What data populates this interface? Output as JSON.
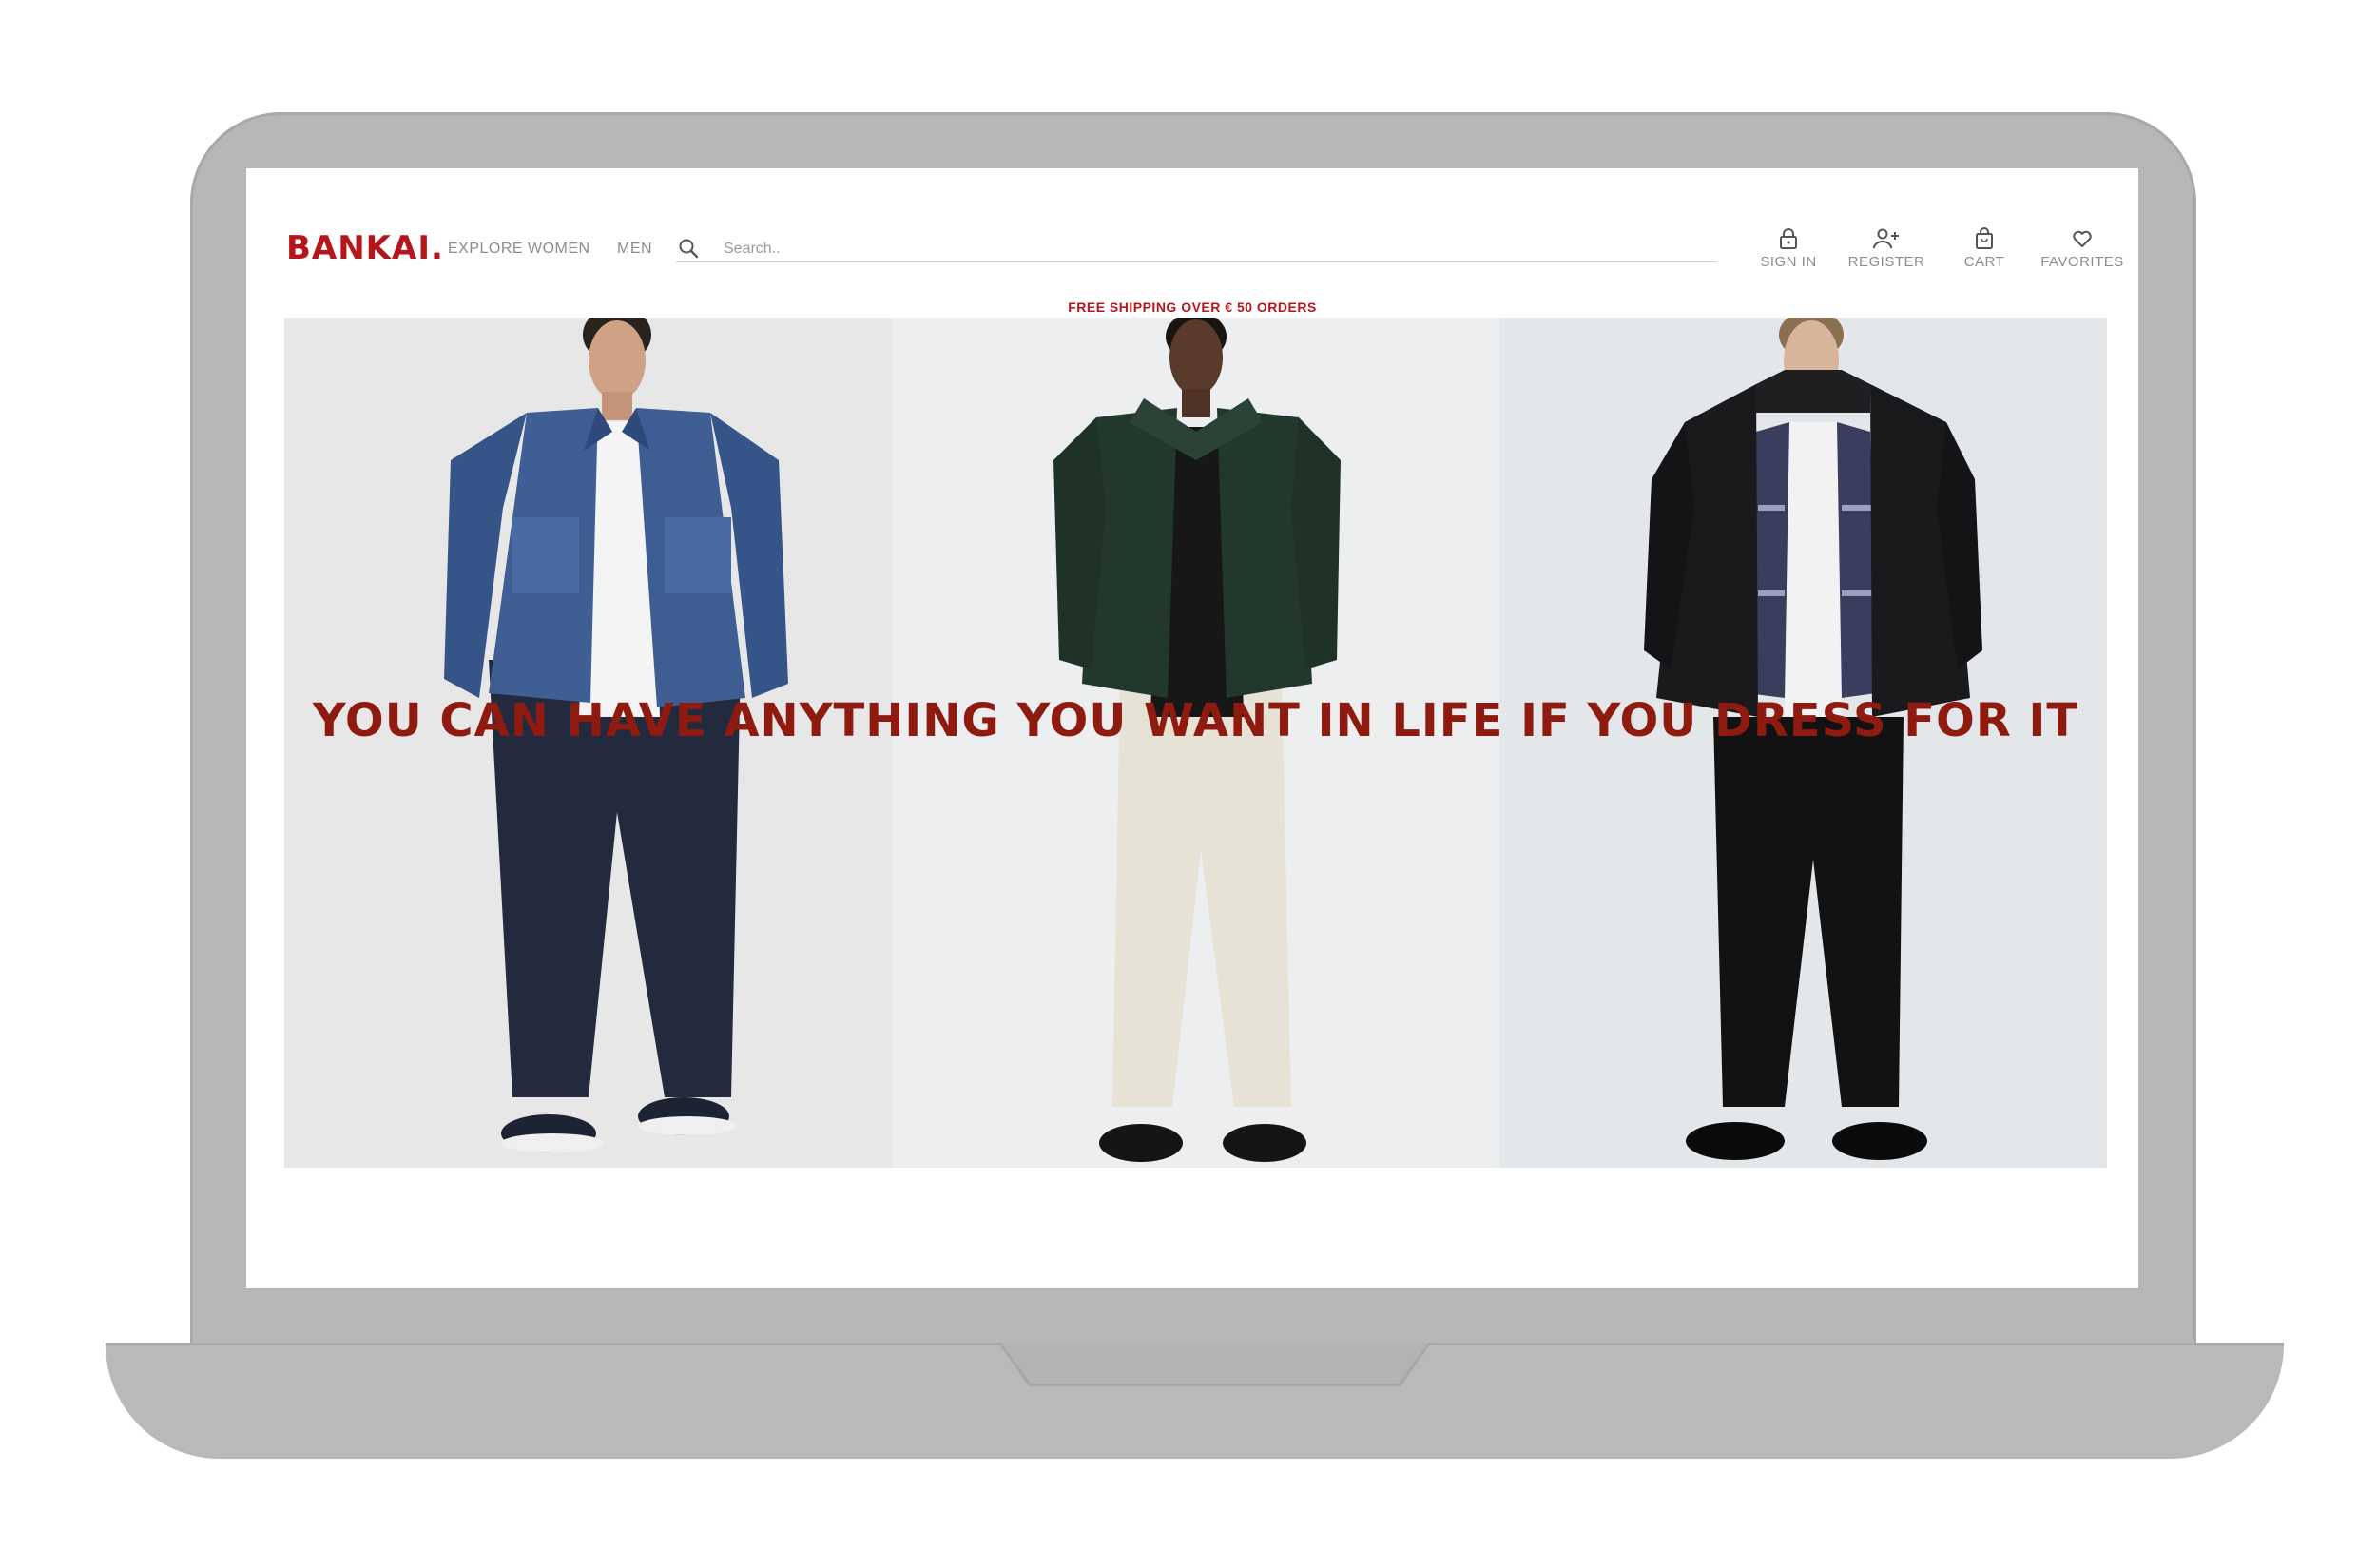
{
  "brand": {
    "name": "BANKAI.",
    "accent": "#b5161b"
  },
  "nav": {
    "items": [
      {
        "label": "EXPLORE"
      },
      {
        "label": "WOMEN"
      },
      {
        "label": "MEN"
      }
    ]
  },
  "search": {
    "placeholder": "Search..",
    "icon": "search-icon"
  },
  "account": {
    "items": [
      {
        "label": "SIGN IN",
        "icon": "lock-icon"
      },
      {
        "label": "REGISTER",
        "icon": "add-user-icon"
      },
      {
        "label": "CART",
        "icon": "shopping-bag-icon"
      },
      {
        "label": "FAVORITES",
        "icon": "heart-icon"
      }
    ]
  },
  "promo": {
    "text": "FREE SHIPPING OVER € 50 ORDERS"
  },
  "hero": {
    "headline": "YOU CAN HAVE ANYTHING YOU WANT IN LIFE IF YOU DRESS FOR IT",
    "headline_color": "#8e1a10",
    "images": [
      {
        "alt": "Model in denim jacket and navy trousers"
      },
      {
        "alt": "Model in green jacket and ecru jeans"
      },
      {
        "alt": "Model in black puffer jacket and black trousers"
      }
    ]
  }
}
